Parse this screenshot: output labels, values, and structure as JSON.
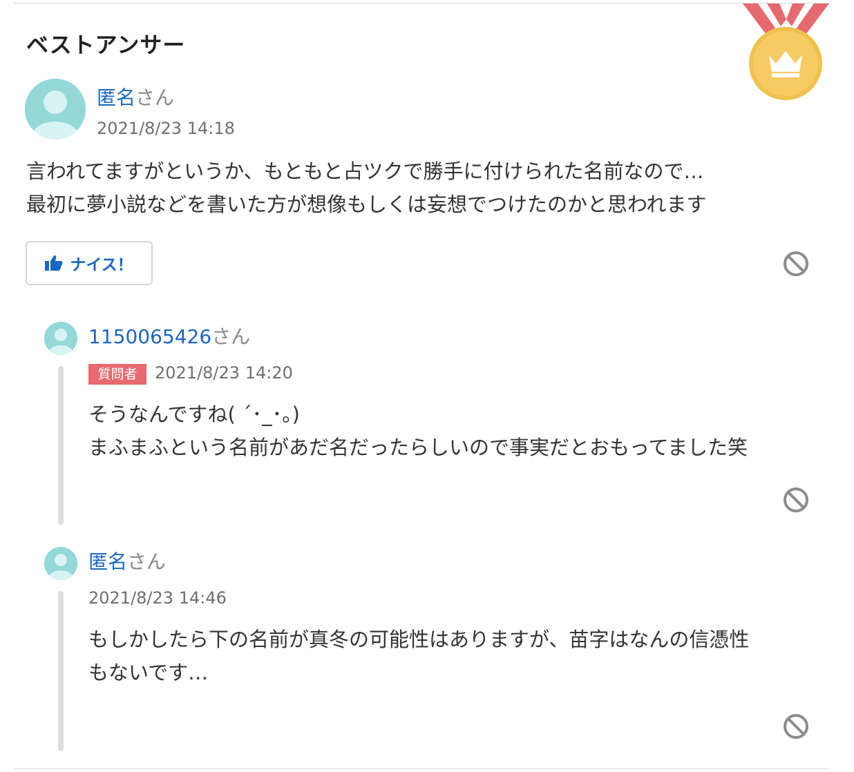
{
  "header": {
    "title": "ベストアンサー"
  },
  "best_answer": {
    "author_name": "匿名",
    "author_suffix": "さん",
    "timestamp": "2021/8/23 14:18",
    "body_lines": [
      "言われてますがというか、もともと占ツクで勝手に付けられた名前なので…",
      "最初に夢小説などを書いた方が想像もしくは妄想でつけたのかと思われます"
    ],
    "nice_label": "ナイス！"
  },
  "replies": [
    {
      "author_name": "1150065426",
      "author_suffix": "さん",
      "badge": "質問者",
      "timestamp": "2021/8/23 14:20",
      "body_lines": [
        "そうなんですね( ˊ･_･。)",
        "まふまふという名前があだ名だったらしいので事実だとおもってました笑"
      ]
    },
    {
      "author_name": "匿名",
      "author_suffix": "さん",
      "timestamp": "2021/8/23 14:46",
      "body_lines": [
        "もしかしたら下の名前が真冬の可能性はありますが、苗字はなんの信憑性",
        "もないです…"
      ]
    }
  ],
  "icons": {
    "medal": "best-answer-medal-icon",
    "report": "report-ban-icon",
    "thumb": "thumbs-up-icon"
  },
  "colors": {
    "link": "#1a66c2",
    "badge": "#e8696f",
    "medal_gold": "#f5c24a",
    "ribbon": "#e5696f",
    "avatar": "#94d8d8"
  }
}
